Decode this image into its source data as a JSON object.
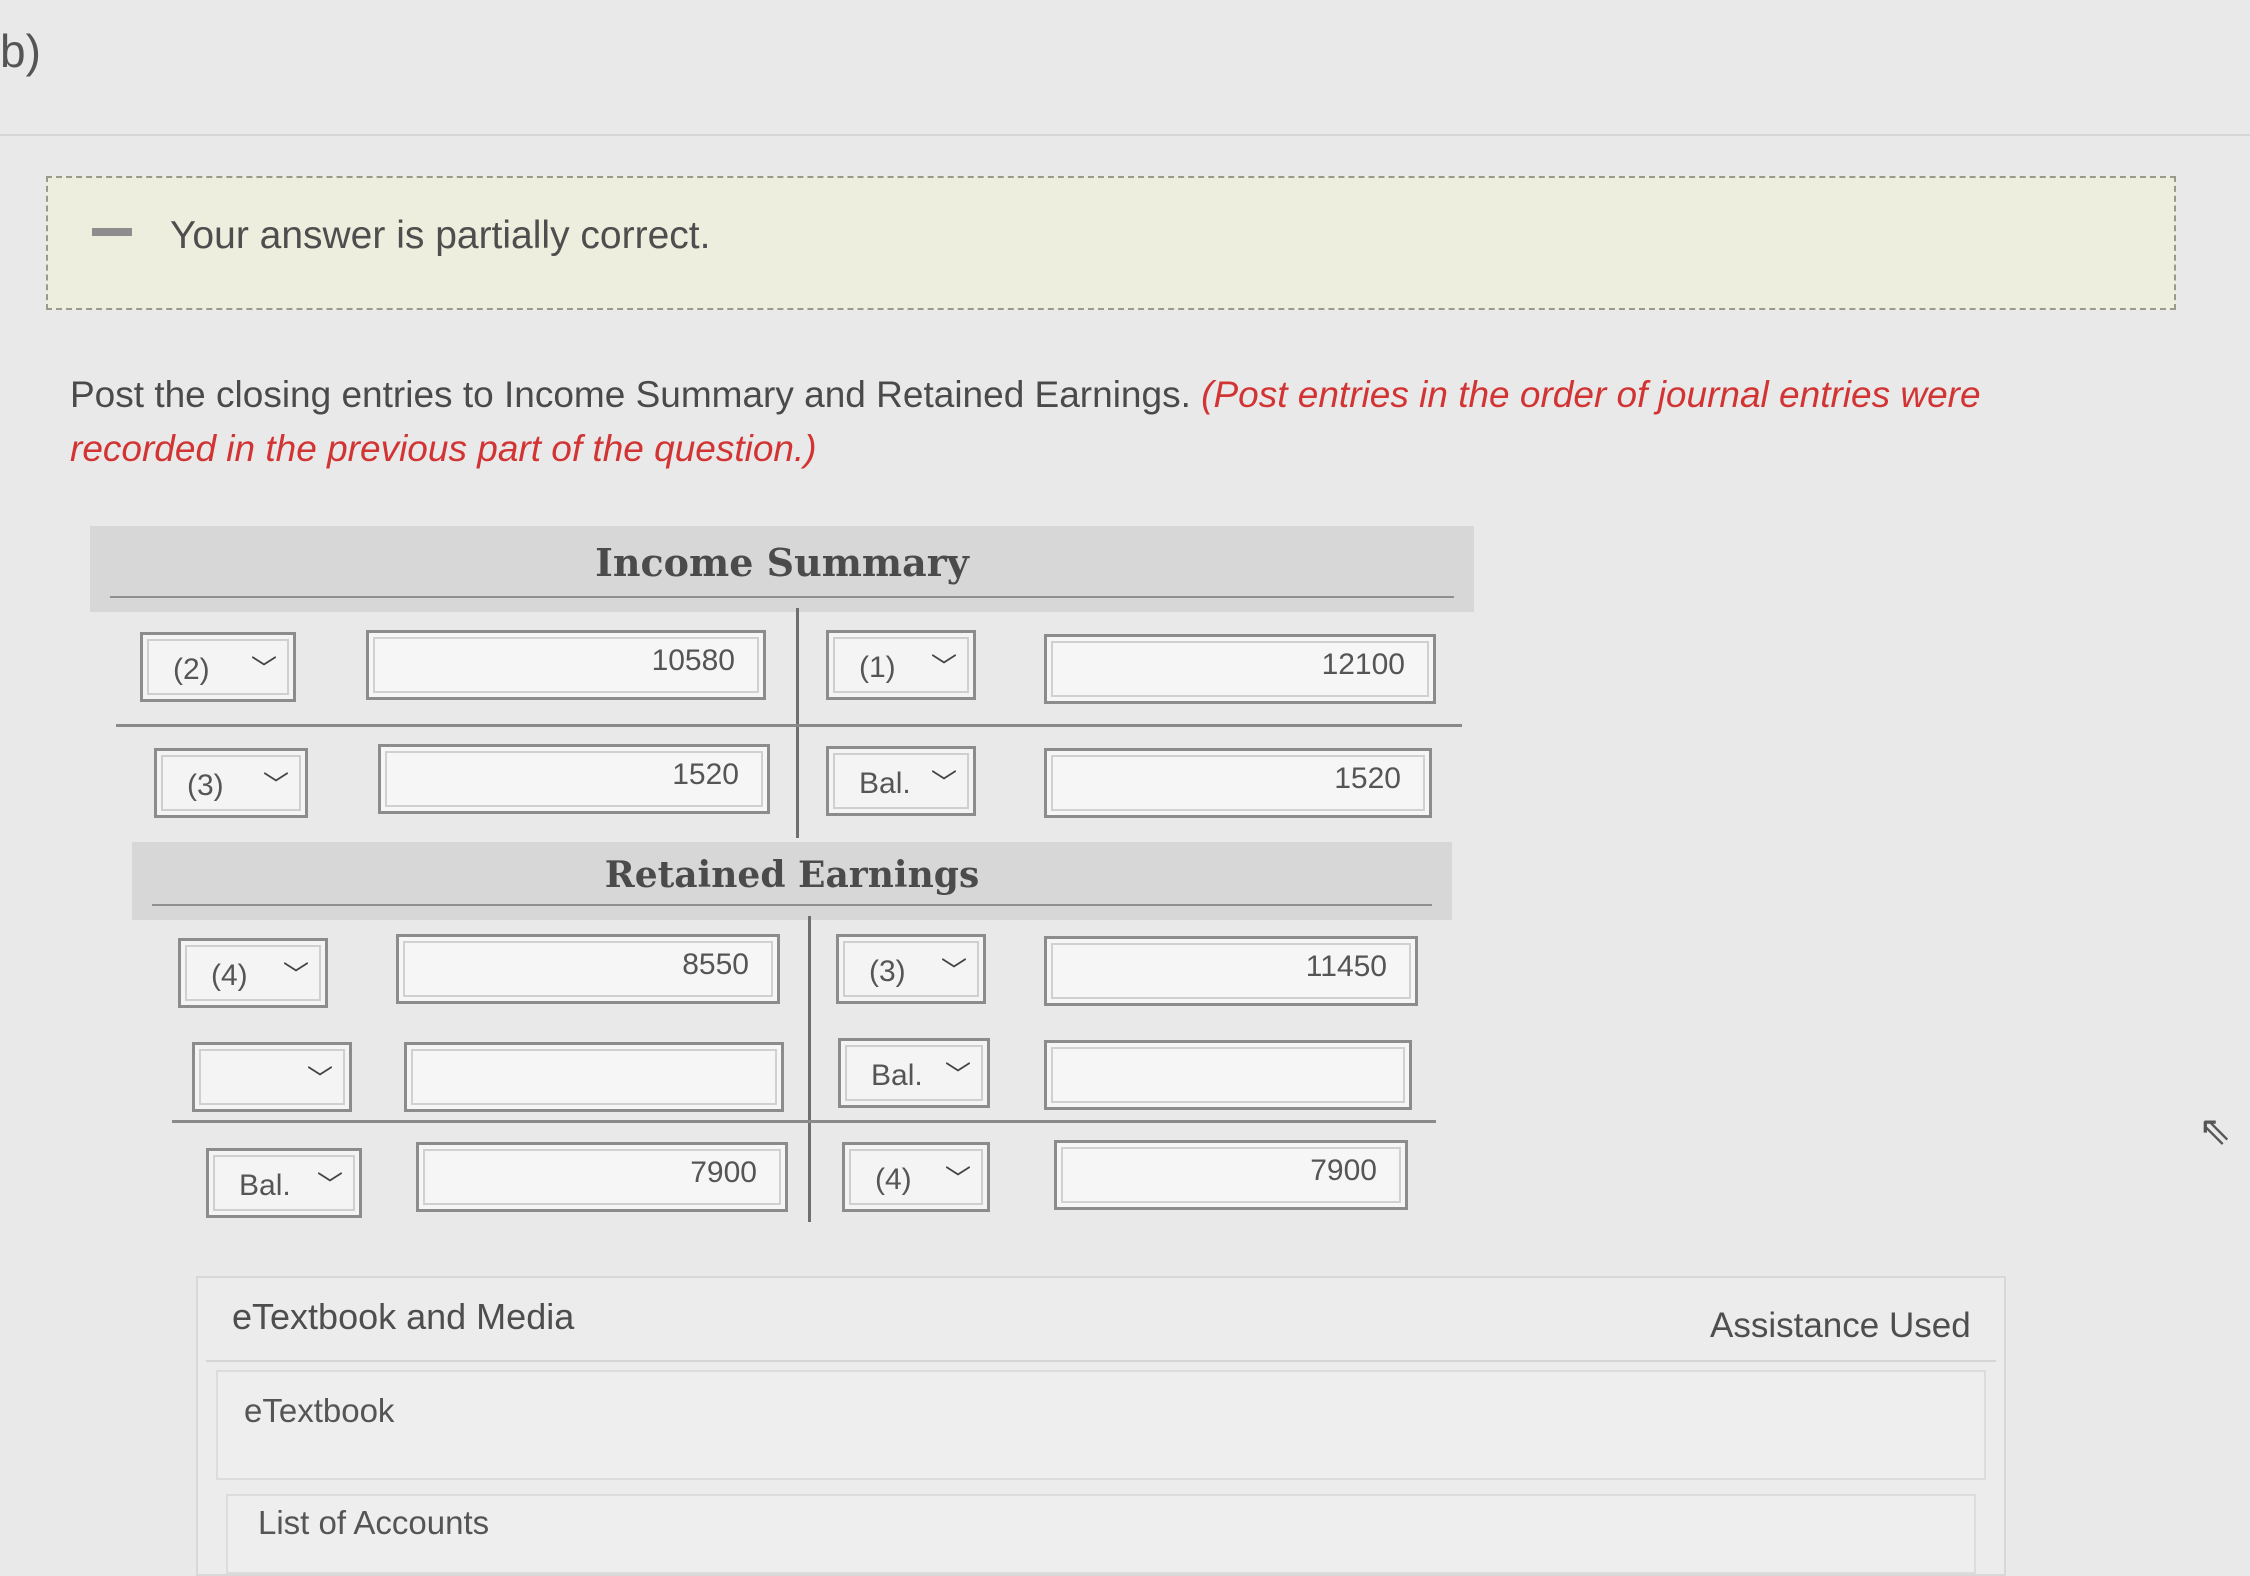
{
  "part_label": "b)",
  "feedback": {
    "message": "Your answer is partially correct."
  },
  "instruction": {
    "text": "Post the closing entries to Income Summary and Retained Earnings.",
    "hint": "(Post entries in the order of journal entries were recorded in the previous part of the question.)"
  },
  "income_summary": {
    "title": "Income Summary",
    "rows": [
      {
        "debit_ref": "(2)",
        "debit_amount": "10580",
        "credit_ref": "(1)",
        "credit_amount": "12100"
      },
      {
        "debit_ref": "(3)",
        "debit_amount": "1520",
        "credit_ref": "Bal.",
        "credit_amount": "1520"
      }
    ]
  },
  "retained_earnings": {
    "title": "Retained Earnings",
    "rows": [
      {
        "debit_ref": "(4)",
        "debit_amount": "8550",
        "credit_ref": "(3)",
        "credit_amount": "11450"
      },
      {
        "debit_ref": "",
        "debit_amount": "",
        "credit_ref": "Bal.",
        "credit_amount": ""
      },
      {
        "debit_ref": "Bal.",
        "debit_amount": "7900",
        "credit_ref": "(4)",
        "credit_amount": "7900"
      }
    ]
  },
  "media": {
    "title": "eTextbook and Media",
    "assistance": "Assistance Used",
    "items": [
      "eTextbook",
      "List of Accounts"
    ]
  },
  "icons": {
    "dropdown": "chevron-down-icon",
    "status": "partial-dash-icon",
    "cursor": "mouse-cursor-icon"
  }
}
